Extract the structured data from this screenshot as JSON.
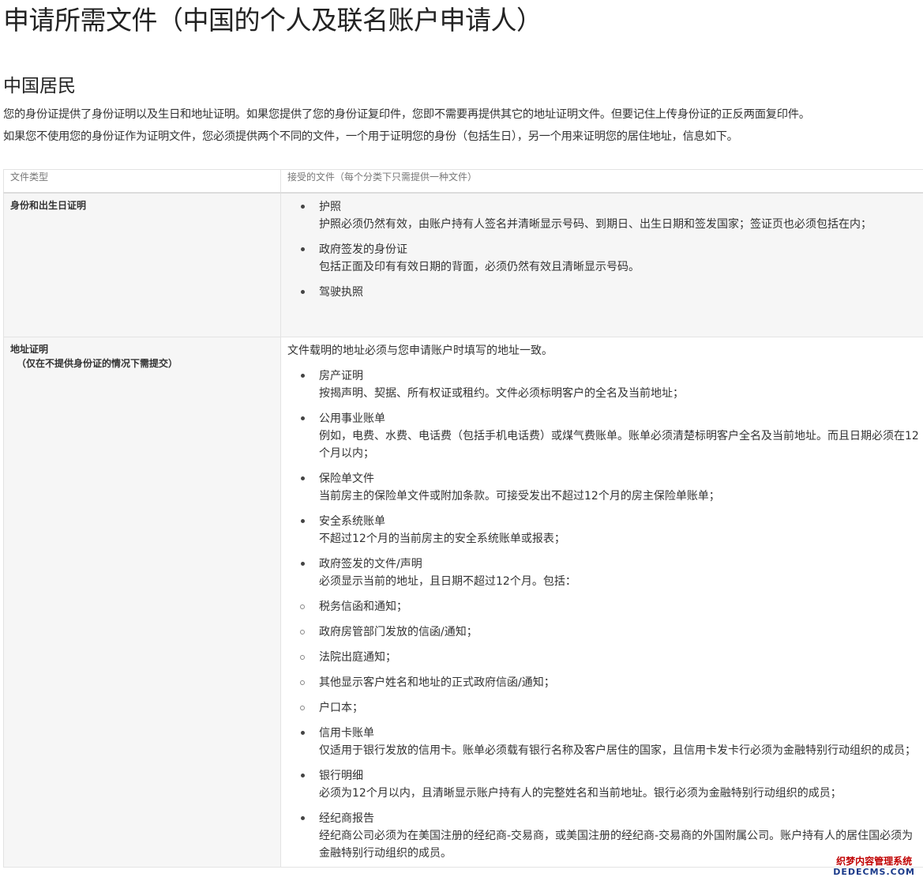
{
  "page": {
    "title": "申请所需文件（中国的个人及联名账户申请人）",
    "section_title": "中国居民",
    "intro": [
      "您的身份证提供了身份证明以及生日和地址证明。如果您提供了您的身份证复印件，您即不需要再提供其它的地址证明文件。但要记住上传身份证的正反两面复印件。",
      "如果您不使用您的身份证作为证明文件，您必须提供两个不同的文件，一个用于证明您的身份（包括生日），另一个用来证明您的居住地址，信息如下。"
    ]
  },
  "table": {
    "headers": [
      "文件类型",
      "接受的文件（每个分类下只需提供一种文件）"
    ],
    "identity": {
      "label": "身份和出生日证明",
      "items": [
        {
          "title": "护照",
          "desc": "护照必须仍然有效，由账户持有人签名并清晰显示号码、到期日、出生日期和签发国家；签证页也必须包括在内；"
        },
        {
          "title": "政府签发的身份证",
          "desc": "包括正面及印有有效日期的背面，必须仍然有效且清晰显示号码。"
        },
        {
          "title": "驾驶执照",
          "desc": ""
        }
      ]
    },
    "address": {
      "label": "地址证明",
      "sublabel": "（仅在不提供身份证的情况下需提交）",
      "lead": "文件载明的地址必须与您申请账户时填写的地址一致。",
      "items": [
        {
          "kind": "bullet",
          "title": "房产证明",
          "desc": "按揭声明、契据、所有权证或租约。文件必须标明客户的全名及当前地址；"
        },
        {
          "kind": "bullet",
          "title": "公用事业账单",
          "desc": "例如，电费、水费、电话费（包括手机电话费）或煤气费账单。账单必须清楚标明客户全名及当前地址。而且日期必须在12个月以内；"
        },
        {
          "kind": "bullet",
          "title": "保险单文件",
          "desc": "当前房主的保险单文件或附加条款。可接受发出不超过12个月的房主保险单账单；"
        },
        {
          "kind": "bullet",
          "title": "安全系统账单",
          "desc": "不超过12个月的当前房主的安全系统账单或报表；"
        },
        {
          "kind": "bullet",
          "title": "政府签发的文件/声明",
          "desc": "必须显示当前的地址，且日期不超过12个月。包括："
        },
        {
          "kind": "circle",
          "title": "税务信函和通知；",
          "desc": ""
        },
        {
          "kind": "circle",
          "title": "政府房管部门发放的信函/通知；",
          "desc": ""
        },
        {
          "kind": "circle",
          "title": "法院出庭通知；",
          "desc": ""
        },
        {
          "kind": "circle",
          "title": "其他显示客户姓名和地址的正式政府信函/通知；",
          "desc": ""
        },
        {
          "kind": "circle",
          "title": "户口本；",
          "desc": ""
        },
        {
          "kind": "bullet",
          "title": "信用卡账单",
          "desc": "仅适用于银行发放的信用卡。账单必须载有银行名称及客户居住的国家，且信用卡发卡行必须为金融特别行动组织的成员；"
        },
        {
          "kind": "bullet",
          "title": "银行明细",
          "desc": "必须为12个月以内，且清晰显示账户持有人的完整姓名和当前地址。银行必须为金融特别行动组织的成员；"
        },
        {
          "kind": "bullet",
          "title": "经纪商报告",
          "desc": "经纪商公司必须为在美国注册的经纪商-交易商，或美国注册的经纪商-交易商的外国附属公司。账户持有人的居住国必须为金融特别行动组织的成员。"
        }
      ]
    }
  },
  "watermark": {
    "cn": "织梦内容管理系统",
    "en": "DEDECMS.COM"
  }
}
